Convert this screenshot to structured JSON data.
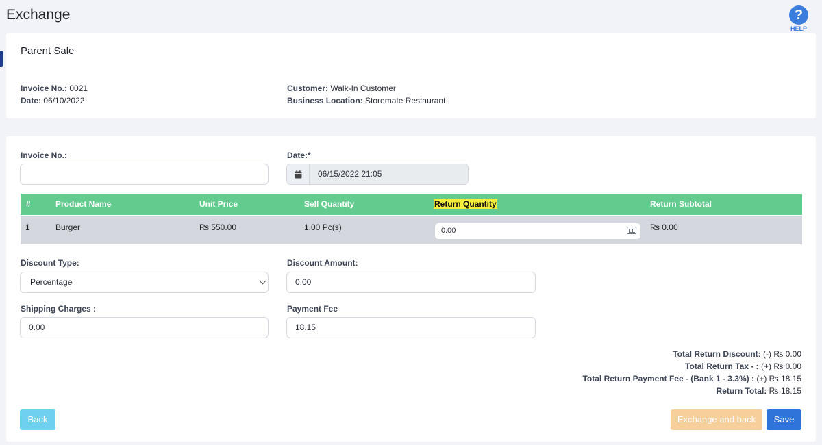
{
  "header": {
    "title": "Exchange",
    "help_label": "HELP",
    "help_glyph": "?"
  },
  "parent_sale": {
    "title": "Parent Sale",
    "invoice_label": "Invoice No.:",
    "invoice_value": "0021",
    "date_label": "Date:",
    "date_value": "06/10/2022",
    "customer_label": "Customer:",
    "customer_value": "Walk-In Customer",
    "location_label": "Business Location:",
    "location_value": "Storemate Restaurant"
  },
  "form": {
    "invoice_label": "Invoice No.:",
    "invoice_value": "",
    "date_label": "Date:*",
    "date_value": "06/15/2022 21:05",
    "discount_type_label": "Discount Type:",
    "discount_type_value": "Percentage",
    "discount_amount_label": "Discount Amount:",
    "discount_amount_value": "0.00",
    "shipping_label": "Shipping Charges :",
    "shipping_value": "0.00",
    "payment_fee_label": "Payment Fee",
    "payment_fee_value": "18.15"
  },
  "table": {
    "headers": [
      "#",
      "Product Name",
      "Unit Price",
      "Sell Quantity",
      "Return Quantity",
      "Return Subtotal"
    ],
    "rows": [
      {
        "num": "1",
        "product": "Burger",
        "unit_price": "₨ 550.00",
        "sell_qty": "1.00 Pc(s)",
        "return_qty": "0.00",
        "return_subtotal": "₨ 0.00"
      }
    ]
  },
  "totals": {
    "discount_label": "Total Return Discount:",
    "discount_value": "(-) ₨ 0.00",
    "tax_label": "Total Return Tax - :",
    "tax_value": "(+) ₨ 0.00",
    "fee_label": "Total Return Payment Fee - (Bank 1 - 3.3%) :",
    "fee_value": "(+) ₨ 18.15",
    "total_label": "Return Total:",
    "total_value": "₨ 18.15"
  },
  "buttons": {
    "back": "Back",
    "exchange_back": "Exchange and back",
    "save": "Save"
  },
  "colors": {
    "table_header": "#63cb8e",
    "highlight": "#f5ef3b",
    "primary": "#2f74d9",
    "info": "#6fd0ef",
    "warning": "#f7cf9a"
  }
}
